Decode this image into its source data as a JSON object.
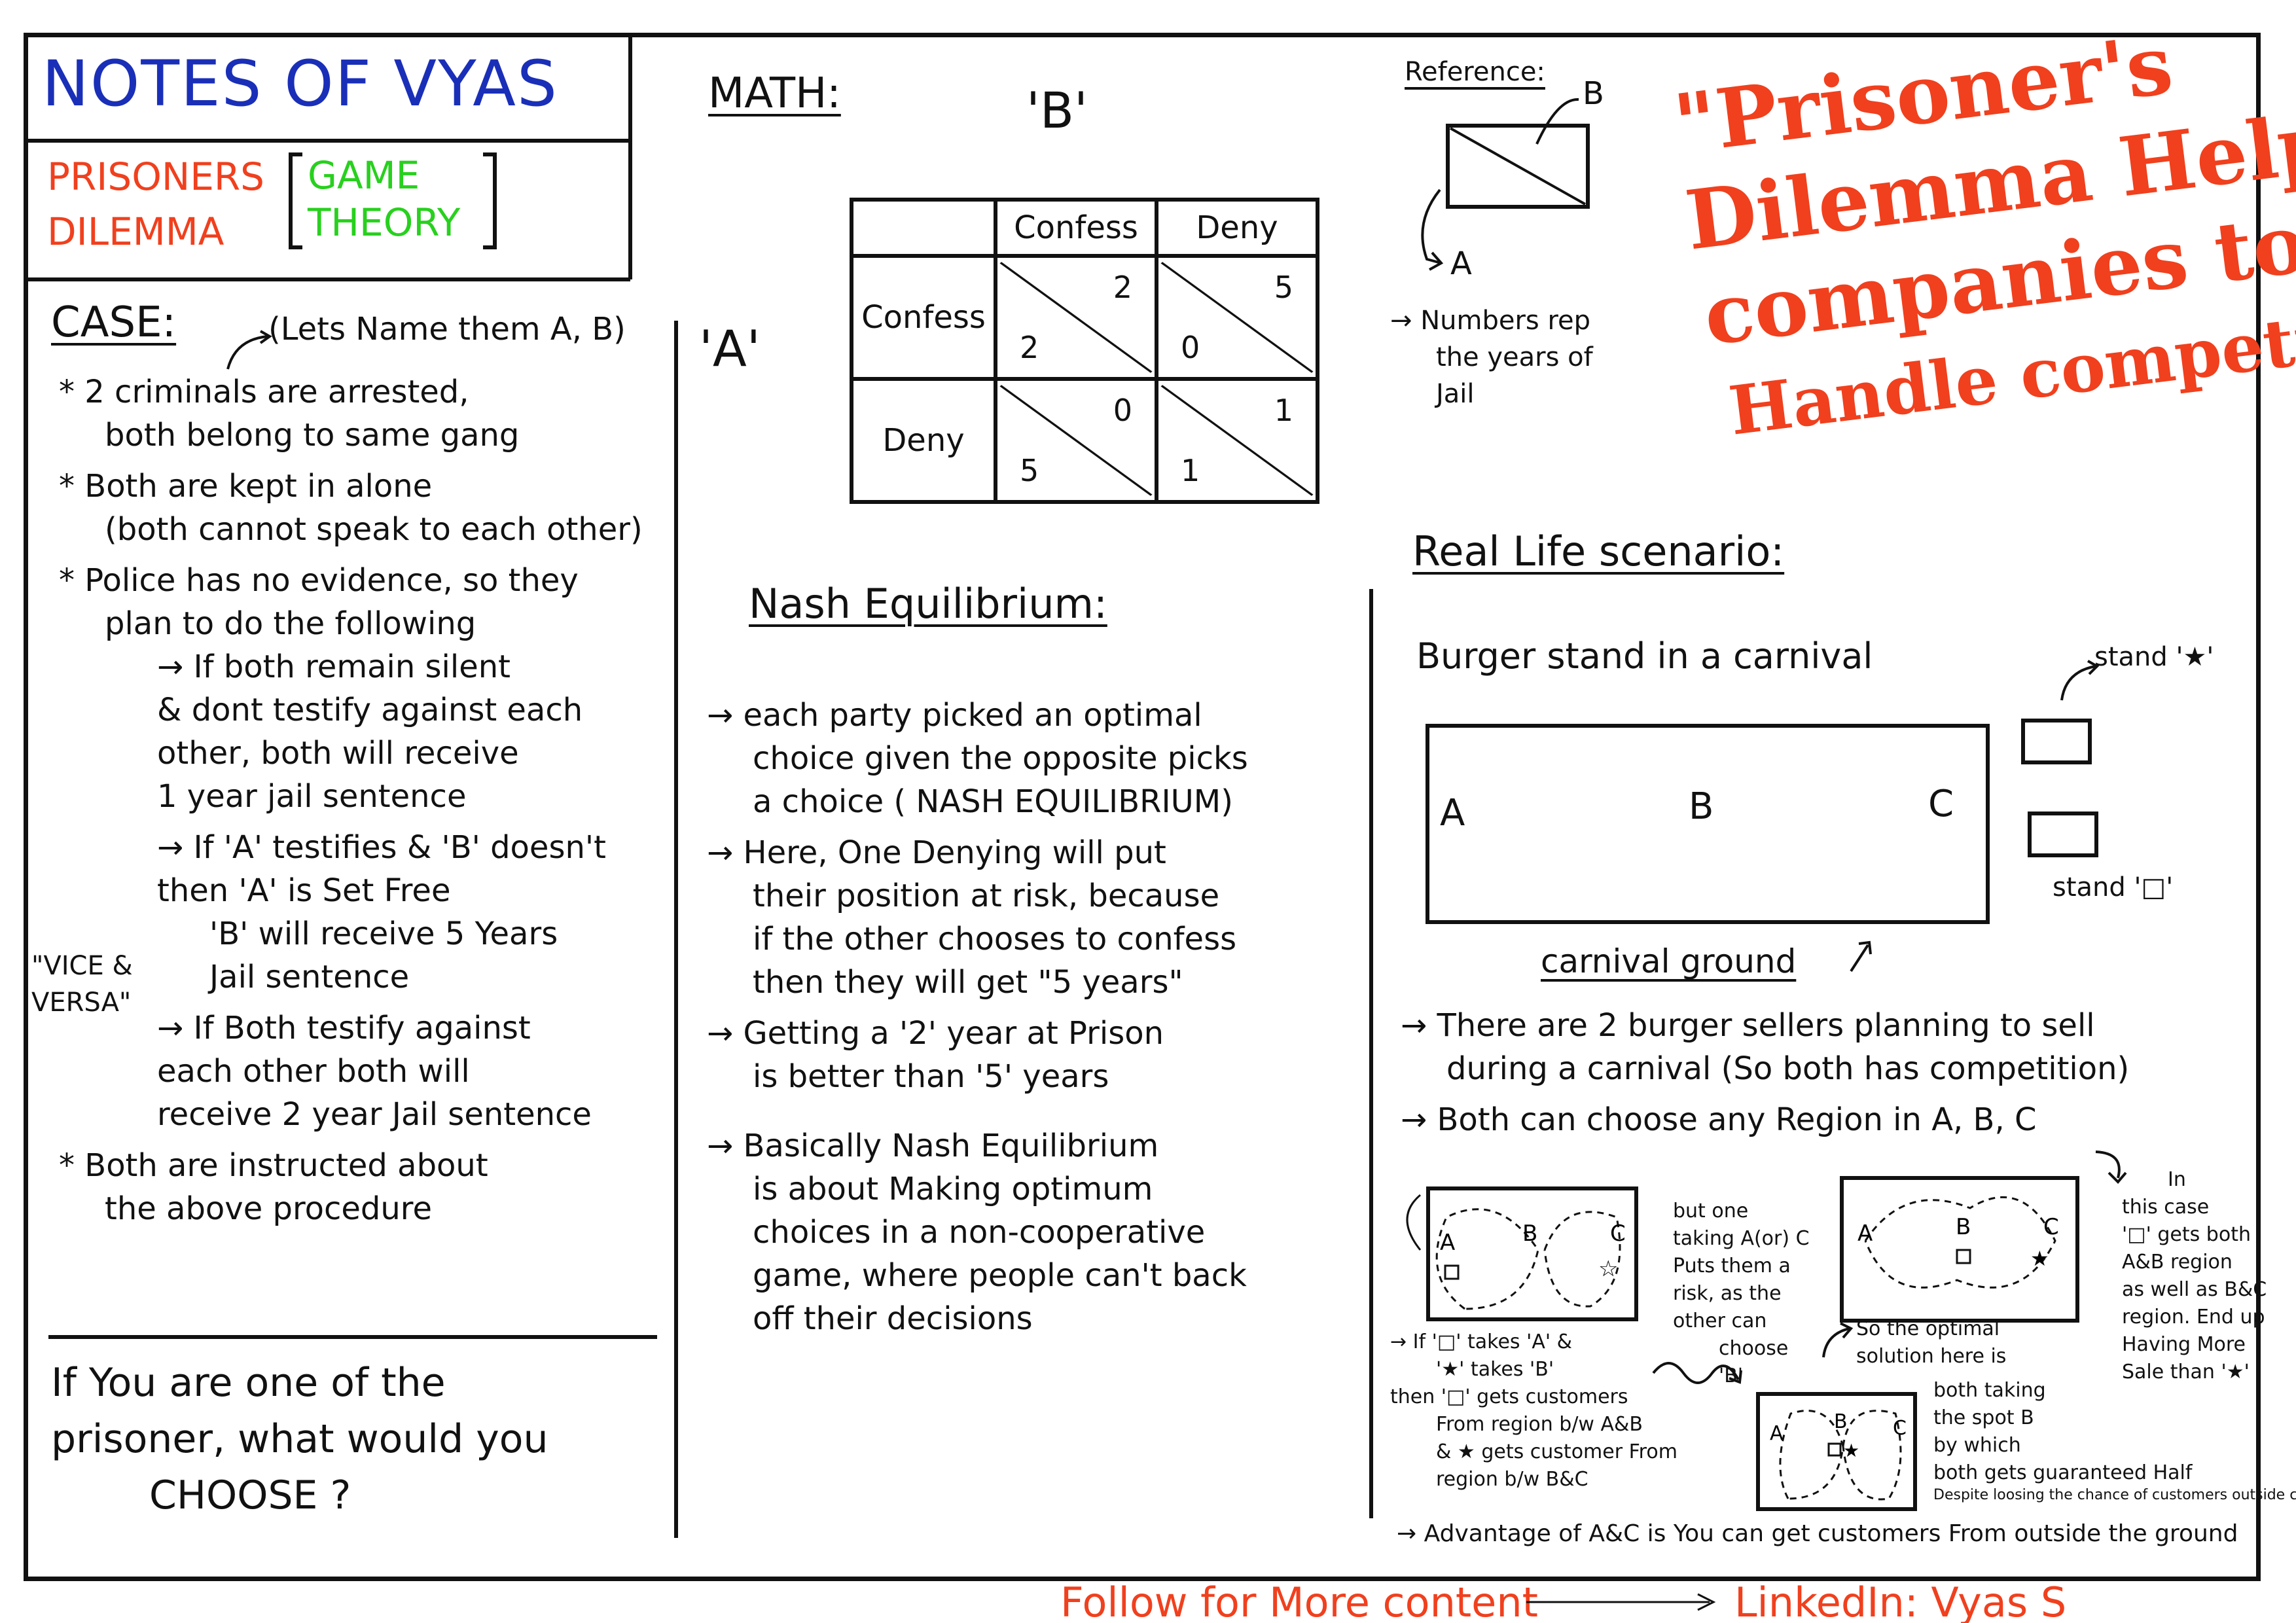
{
  "header": {
    "title": "NOTES OF VYAS",
    "topic_line1": "PRISONERS",
    "topic_line2": "DILEMMA",
    "tag_line1": "GAME",
    "tag_line2": "THEORY"
  },
  "case": {
    "heading": "CASE:",
    "naming_note": "(Lets Name them A, B)",
    "points": [
      "* 2 criminals are arrested,",
      "both belong to same gang",
      "* Both are kept in alone",
      "(both cannot speak to each other)",
      "* Police has no evidence, so they",
      "plan to do the following",
      "→ If both remain silent",
      "& dont testify against each",
      "other, both will receive",
      "1 year jail sentence",
      "→ If 'A' testifies & 'B' doesn't",
      "then 'A' is Set Free",
      "'B' will receive 5 Years",
      "Jail sentence",
      "→ If Both testify against",
      "each other both will",
      "receive 2 year Jail sentence",
      "* Both are instructed about",
      "the above procedure"
    ],
    "vice_versa_1": "\"VICE &",
    "vice_versa_2": "VERSA\""
  },
  "question": {
    "line1": "If You are one of the",
    "line2": "prisoner, what would you",
    "line3": "CHOOSE ?"
  },
  "math": {
    "heading": "MATH:",
    "player_b": "'B'",
    "player_a": "'A'",
    "col_labels": [
      "Confess",
      "Deny"
    ],
    "row_labels": [
      "Confess",
      "Deny"
    ],
    "cells": [
      [
        {
          "b": "2",
          "a": "2"
        },
        {
          "b": "5",
          "a": "0"
        }
      ],
      [
        {
          "b": "0",
          "a": "5"
        },
        {
          "b": "1",
          "a": "1"
        }
      ]
    ]
  },
  "nash": {
    "heading": "Nash Equilibrium:",
    "p1": [
      "→ each party picked an optimal",
      "choice given the opposite picks",
      "a choice ( NASH EQUILIBRIUM)"
    ],
    "p2": [
      "→ Here, One Denying will put",
      "their position at risk, because",
      "if the other chooses to confess",
      "then they will get \"5 years\""
    ],
    "p3": [
      "→ Getting a '2' year at Prison",
      "is better than '5' years"
    ],
    "p4": [
      "→ Basically Nash Equilibrium",
      "is about Making optimum",
      "choices in a non-cooperative",
      "game, where people can't back",
      "off their decisions"
    ]
  },
  "reference": {
    "heading": "Reference:",
    "b": "B",
    "a": "A",
    "note": [
      "→ Numbers rep",
      "the years of",
      "Jail"
    ]
  },
  "quote": {
    "line1": "\"Prisoner's",
    "line2": "Dilemma Helps",
    "line3": "companies to",
    "line4": "Handle competition\""
  },
  "real_life": {
    "heading": "Real Life scenario:",
    "subtitle": "Burger stand in a carnival",
    "region_a": "A",
    "region_b": "B",
    "region_c": "C",
    "stand_star": "stand '★'",
    "stand_square": "stand '□'",
    "ground_label": "carnival ground",
    "points": [
      "→ There are 2 burger sellers planning to sell",
      "during a carnival (So both has competition)",
      "→ Both can choose any Region in A, B, C"
    ],
    "d1_note": [
      "but one",
      "taking A(or) C",
      "Puts them a",
      "risk, as the",
      "other can",
      "choose",
      "'B'"
    ],
    "left_note": [
      "→ If '□' takes 'A' &",
      "'★' takes 'B'",
      "then '□' gets customers",
      "From region b/w A&B",
      "& ★ gets customer From",
      "region b/w B&C"
    ],
    "optimal_note": [
      "So the optimal",
      "solution here is"
    ],
    "d3_note": [
      "both taking",
      "the spot B",
      "by which",
      "both gets guaranteed Half"
    ],
    "d3_note_small": "Despite loosing the chance of customers outside carnival",
    "right_note": [
      "In",
      "this case",
      "'□' gets both",
      "A&B region",
      "as well as B&C",
      "region. End up",
      "Having More",
      "Sale than '★'"
    ],
    "advantage": "→ Advantage of A&C is You can get customers From outside the ground"
  },
  "footer": {
    "follow": "Follow for More content",
    "linkedin": "LinkedIn: Vyas S"
  }
}
